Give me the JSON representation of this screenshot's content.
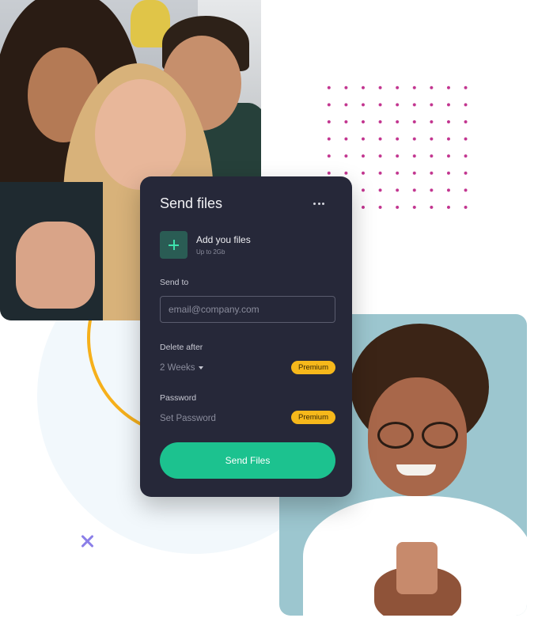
{
  "card": {
    "title": "Send files",
    "more_icon": "more-horizontal-icon",
    "add_icon": "plus-icon",
    "add_title": "Add you files",
    "add_subtitle": "Up to 2Gb",
    "send_to_label": "Send to",
    "email_placeholder": "email@company.com",
    "delete_after_label": "Delete after",
    "delete_after_value": "2 Weeks",
    "dropdown_icon": "caret-down-icon",
    "premium_badge": "Premium",
    "password_label": "Password",
    "password_placeholder": "Set Password",
    "send_button": "Send Files"
  },
  "colors": {
    "card_bg": "#262839",
    "accent_green": "#1cc28f",
    "premium_yellow": "#f6b81b",
    "ring_yellow": "#f6b01b",
    "dots_magenta": "#c2348f",
    "x_purple": "#8b7fe8"
  }
}
